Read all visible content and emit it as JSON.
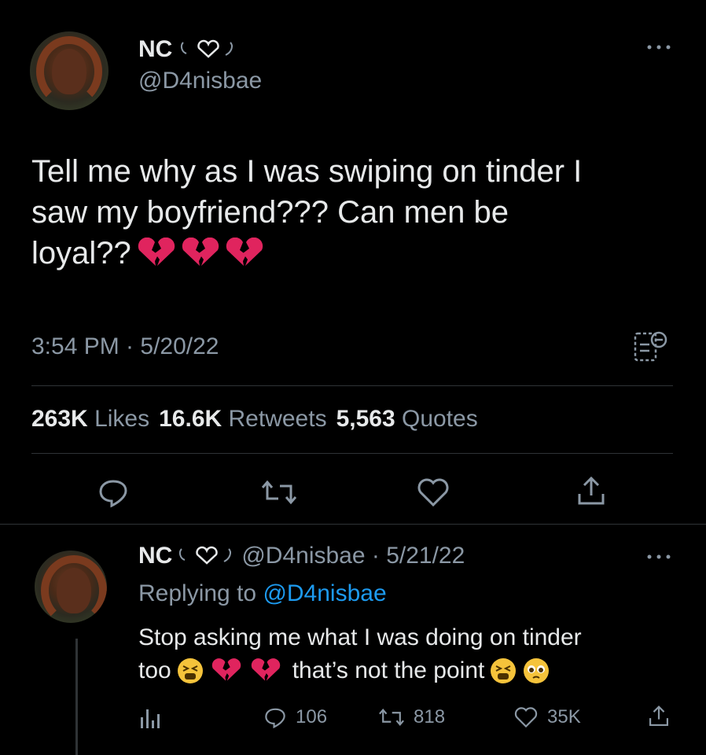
{
  "main_tweet": {
    "author": {
      "name": "NC",
      "handle": "@D4nisbae"
    },
    "text_line1": "Tell me why as I was swiping on tinder I",
    "text_line2": "saw my boyfriend??? Can men be",
    "text_line3": "loyal??",
    "timestamp": "3:54 PM · 5/20/22",
    "stats": {
      "likes_count": "263K",
      "likes_label": "Likes",
      "retweets_count": "16.6K",
      "retweets_label": "Retweets",
      "quotes_count": "5,563",
      "quotes_label": "Quotes"
    }
  },
  "reply_tweet": {
    "author": {
      "name": "NC",
      "handle_date": "@D4nisbae · 5/21/22"
    },
    "replying_prefix": "Replying to ",
    "replying_handle": "@D4nisbae",
    "text_line1": "Stop asking me what I was doing on tinder",
    "text_line2_a": "too",
    "text_line2_b": "that’s not the point",
    "actions": {
      "reply_count": "106",
      "retweet_count": "818",
      "like_count": "35K"
    }
  },
  "colors": {
    "background": "#000000",
    "text": "#e7e9ea",
    "secondary": "#8b98a5",
    "link": "#1d9bf0",
    "divider": "#2f3336",
    "heart": "#e0245e"
  },
  "icons": [
    "more-icon",
    "translate-icon",
    "reply-icon",
    "retweet-icon",
    "like-icon",
    "share-icon",
    "analytics-icon",
    "broken-heart-icon",
    "tired-face-emoji",
    "pleading-face-emoji",
    "heart-outline-icon"
  ]
}
